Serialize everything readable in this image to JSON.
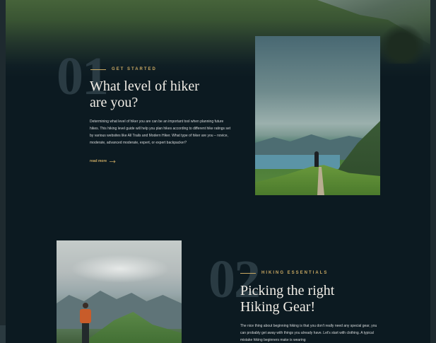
{
  "sections": [
    {
      "number": "01",
      "eyebrow": "GET STARTED",
      "title_line1": "What level of  hiker",
      "title_line2": "are you?",
      "body": "Determining what level of hiker you are can be an important tool when planning future hikes. This hiking level guide will help you plan hikes according to different hike ratings set by various websites like All Trails and Modern Hiker. What type of hiker are you – novice, moderate, advanced moderate, expert, or expert backpacker?",
      "read_more": "read more"
    },
    {
      "number": "02",
      "eyebrow": "HIKING ESSENTIALS",
      "title_line1": "Picking the right",
      "title_line2": "Hiking Gear!",
      "body": "The nice thing about beginning hiking is that you don't really need any special gear, you can probably get away with things you already have. Let's start with clothing. A typical mistake hiking beginners make is wearing"
    }
  ],
  "colors": {
    "background": "#0c1a21",
    "accent": "#c9a862",
    "title": "#f1ede6",
    "number": "#2a3b43"
  },
  "icons": {
    "read_more": "arrow-right-icon"
  }
}
